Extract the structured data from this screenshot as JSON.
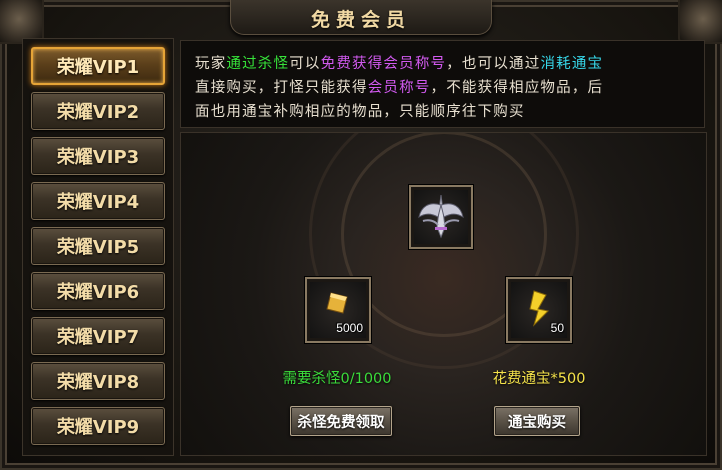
{
  "window": {
    "title": "免费会员"
  },
  "sidebar": {
    "items": [
      {
        "label": "荣耀VIP1",
        "active": true
      },
      {
        "label": "荣耀VIP2",
        "active": false
      },
      {
        "label": "荣耀VIP3",
        "active": false
      },
      {
        "label": "荣耀VIP4",
        "active": false
      },
      {
        "label": "荣耀VIP5",
        "active": false
      },
      {
        "label": "荣耀VIP6",
        "active": false
      },
      {
        "label": "荣耀VIP7",
        "active": false
      },
      {
        "label": "荣耀VIP8",
        "active": false
      },
      {
        "label": "荣耀VIP9",
        "active": false
      }
    ]
  },
  "description": {
    "line1": [
      "玩家",
      "通过杀怪",
      "可以",
      "免费获得会员称号",
      "，也可以通过",
      "消耗通宝"
    ],
    "line2": [
      "直接购买，打怪只能获得",
      "会员称号",
      "，不能获得相应物品，后"
    ],
    "line3": "面也用通宝补购相应的物品，只能顺序往下购买"
  },
  "reward": {
    "icon": "winged-sword-emblem-icon"
  },
  "left_slot": {
    "icon": "gold-ingot-icon",
    "count": "5000"
  },
  "right_slot": {
    "icon": "gold-ticket-icon",
    "count": "50"
  },
  "kill_requirement": "需要杀怪0/1000",
  "cost_text": "花费通宝*500",
  "buttons": {
    "claim": "杀怪免费领取",
    "buy": "通宝购买"
  },
  "colors": {
    "highlight_green": "#37e33a",
    "highlight_purple": "#d25af0",
    "highlight_cyan": "#37d6e8",
    "requirement_green": "#3bdc3b",
    "cost_yellow": "#f4e24a",
    "active_border": "#e6a437"
  }
}
